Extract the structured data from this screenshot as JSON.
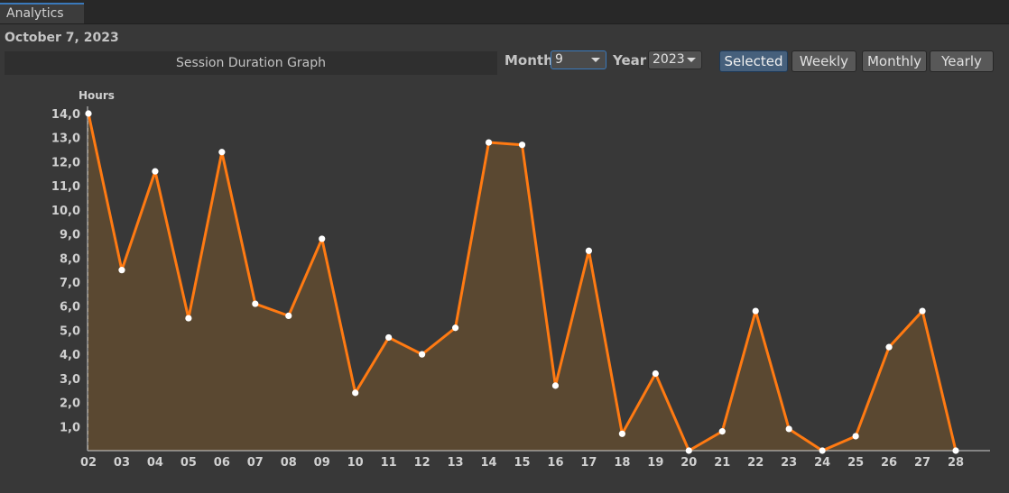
{
  "tab": {
    "label": "Analytics"
  },
  "date": "October 7, 2023",
  "graph_title": "Session Duration Graph",
  "controls": {
    "month_label": "Month",
    "month_value": "9",
    "year_label": "Year",
    "year_value": "2023",
    "buttons": [
      "Selected",
      "Weekly",
      "Monthly",
      "Yearly"
    ]
  },
  "colors": {
    "line": "#ff7a12",
    "area": "#5a4831",
    "selected": "#46607c"
  },
  "chart_data": {
    "type": "area",
    "ylabel": "Hours",
    "xlabel": "",
    "ylim": [
      0,
      14
    ],
    "y_ticks": [
      "1,0",
      "2,0",
      "3,0",
      "4,0",
      "5,0",
      "6,0",
      "7,0",
      "8,0",
      "9,0",
      "10,0",
      "11,0",
      "12,0",
      "13,0",
      "14,0"
    ],
    "x": [
      "02",
      "03",
      "04",
      "05",
      "06",
      "07",
      "08",
      "09",
      "10",
      "11",
      "12",
      "13",
      "14",
      "15",
      "16",
      "17",
      "18",
      "19",
      "20",
      "21",
      "22",
      "23",
      "24",
      "25",
      "26",
      "27",
      "28"
    ],
    "values": [
      14.0,
      7.5,
      11.6,
      5.5,
      12.4,
      6.1,
      5.6,
      8.8,
      2.4,
      4.7,
      4.0,
      5.1,
      12.8,
      12.7,
      2.7,
      8.3,
      0.7,
      3.2,
      0.0,
      0.8,
      5.8,
      0.9,
      0.0,
      0.6,
      4.3,
      5.8,
      0.0
    ],
    "grid": "vertical-dashed",
    "legend": "none"
  }
}
